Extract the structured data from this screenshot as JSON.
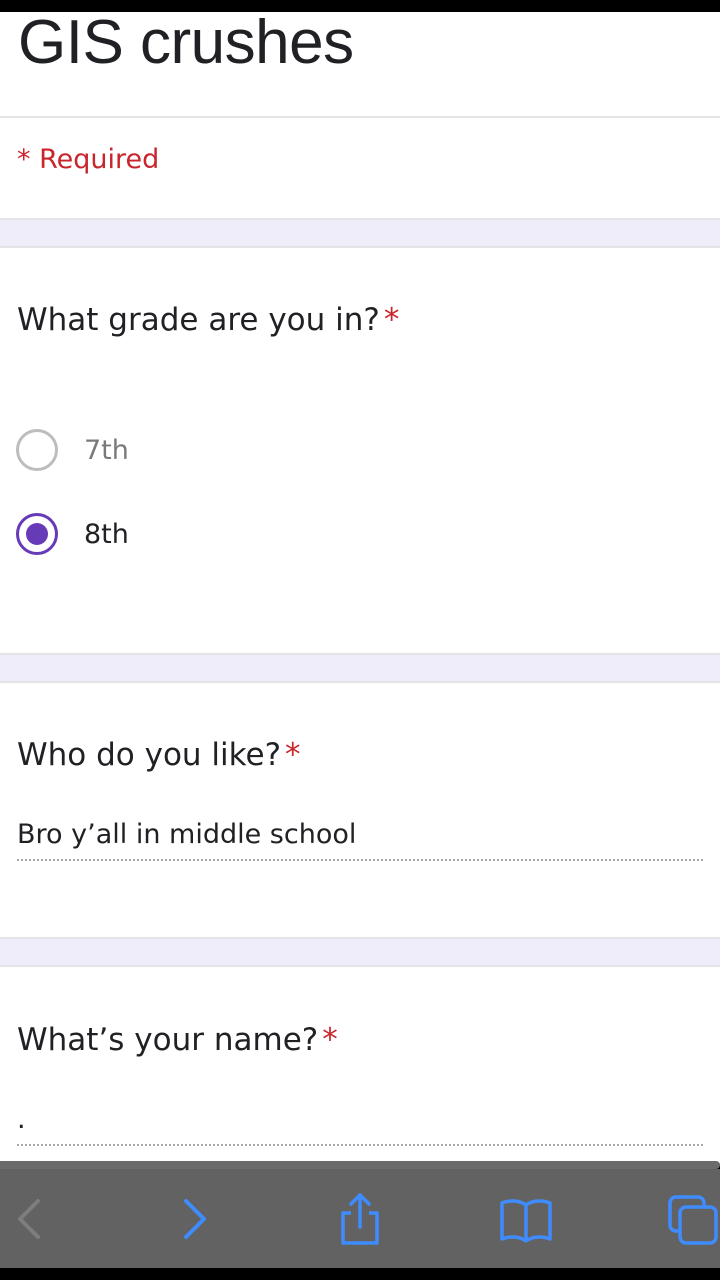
{
  "form": {
    "title": "GIS crushes",
    "required_note": "* Required"
  },
  "questions": [
    {
      "text": "What grade are you in?",
      "required_mark": "*",
      "type": "radio",
      "options": [
        {
          "label": "7th",
          "selected": false
        },
        {
          "label": "8th",
          "selected": true
        }
      ]
    },
    {
      "text": "Who do you like?",
      "required_mark": "*",
      "type": "text",
      "value": "Bro y’all in middle school"
    },
    {
      "text": "What’s your name?",
      "required_mark": "*",
      "type": "text",
      "value": "."
    }
  ],
  "toolbar": {
    "icons": [
      "back-icon",
      "forward-icon",
      "share-icon",
      "bookmarks-icon",
      "tabs-icon"
    ]
  },
  "colors": {
    "accent": "#673ab7",
    "required": "#c8252c",
    "band": "#efedf9",
    "toolbar": "#626262",
    "toolbar_icon": "#3f8cff"
  }
}
